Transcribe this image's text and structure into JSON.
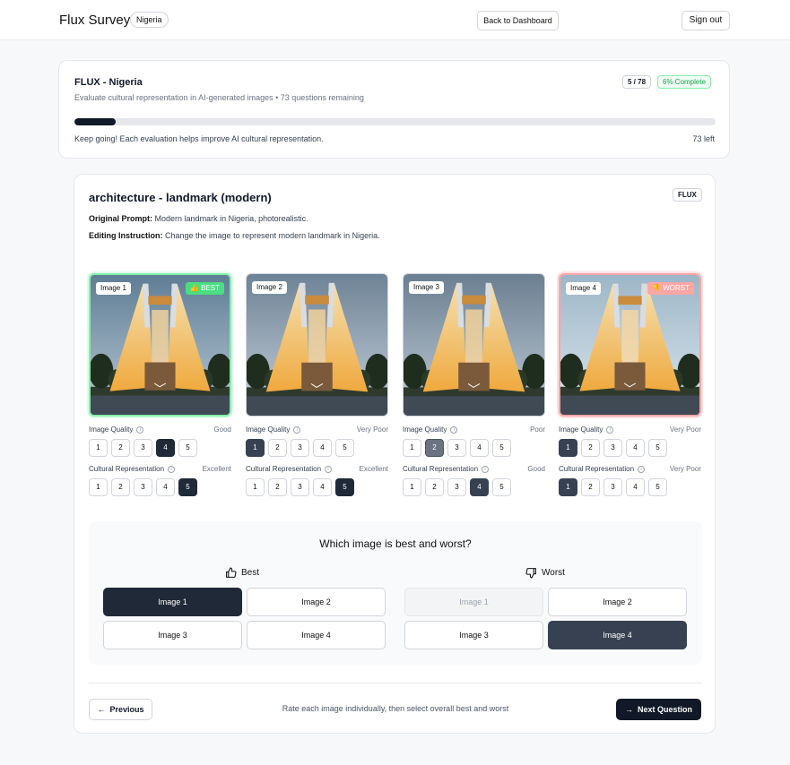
{
  "header": {
    "brand": "Flux Survey",
    "country": "Nigeria",
    "back_label": "Back to Dashboard",
    "signout_label": "Sign out"
  },
  "progress": {
    "title": "FLUX - Nigeria",
    "subtitle": "Evaluate cultural representation in AI-generated images • 73 questions remaining",
    "count": "5 / 78",
    "complete": "6% Complete",
    "fraction": 0.064,
    "message": "Keep going! Each evaluation helps improve AI cultural representation.",
    "left": "73 left"
  },
  "question": {
    "title": "architecture - landmark (modern)",
    "model": "FLUX",
    "prompt_label": "Original Prompt:",
    "prompt": "Modern landmark in Nigeria, photorealistic.",
    "instruction_label": "Editing Instruction:",
    "instruction": "Change the image to represent modern landmark in Nigeria."
  },
  "rating_labels": {
    "quality": "Image Quality",
    "cultural": "Cultural Representation",
    "info_icon": "info-icon",
    "scale": [
      "1",
      "2",
      "3",
      "4",
      "5"
    ]
  },
  "images": [
    {
      "label": "Image 1",
      "tag": "👍 BEST",
      "quality": 4,
      "quality_text": "Good",
      "cultural": 5,
      "cultural_text": "Excellent"
    },
    {
      "label": "Image 2",
      "tag": "",
      "quality": 1,
      "quality_text": "Very Poor",
      "cultural": 5,
      "cultural_text": "Excellent"
    },
    {
      "label": "Image 3",
      "tag": "",
      "quality": 2,
      "quality_text": "Poor",
      "cultural": 4,
      "cultural_text": "Good"
    },
    {
      "label": "Image 4",
      "tag": "👎 WORST",
      "quality": 1,
      "quality_text": "Very Poor",
      "cultural": 1,
      "cultural_text": "Very Poor"
    }
  ],
  "choice": {
    "question": "Which image is best and worst?",
    "best_label": "Best",
    "worst_label": "Worst",
    "options": [
      "Image 1",
      "Image 2",
      "Image 3",
      "Image 4"
    ],
    "best_selected": "Image 1",
    "worst_selected": "Image 4"
  },
  "footer": {
    "previous": "Previous",
    "hint": "Rate each image individually, then select overall best and worst",
    "next": "Next Question"
  }
}
